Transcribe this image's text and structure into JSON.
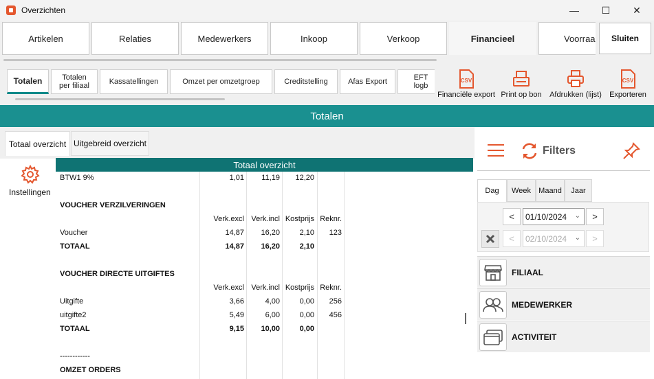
{
  "window": {
    "title": "Overzichten",
    "controls": [
      "minimize",
      "maximize",
      "close"
    ]
  },
  "main_tabs": [
    "Artikelen",
    "Relaties",
    "Medewerkers",
    "Inkoop",
    "Verkoop",
    "Financieel",
    "Voorraa"
  ],
  "main_tabs_active": "Financieel",
  "close_label": "Sluiten",
  "sub_tabs": [
    "Totalen",
    "Totalen per filiaal",
    "Kassatellingen",
    "Omzet per omzetgroep",
    "Creditstelling",
    "Afas Export",
    "EFT logb"
  ],
  "sub_tabs_active": "Totalen",
  "toolbar": [
    {
      "label": "Financiële export",
      "icon": "csv-file-icon"
    },
    {
      "label": "Print op bon",
      "icon": "receipt-printer-icon"
    },
    {
      "label": "Afdrukken (lijst)",
      "icon": "printer-icon"
    },
    {
      "label": "Exporteren",
      "icon": "csv-file-icon"
    }
  ],
  "header_title": "Totalen",
  "content_tabs": [
    "Totaal overzicht",
    "Uitgebreid overzicht"
  ],
  "content_tabs_active": "Totaal overzicht",
  "settings_label": "Instellingen",
  "table": {
    "title": "Totaal overzicht",
    "rows": [
      {
        "label": "BTW1 9%",
        "bold": false,
        "values": [
          "1,01",
          "11,19",
          "12,20",
          ""
        ]
      },
      {
        "label": "",
        "bold": false,
        "values": [
          "",
          "",
          "",
          ""
        ]
      },
      {
        "label": "VOUCHER VERZILVERINGEN",
        "bold": true,
        "values": [
          "",
          "",
          "",
          ""
        ]
      },
      {
        "label": "",
        "bold": false,
        "values": [
          "Verk.excl",
          "Verk.incl",
          "Kostprijs",
          "Reknr."
        ]
      },
      {
        "label": "Voucher",
        "bold": false,
        "values": [
          "14,87",
          "16,20",
          "2,10",
          "123"
        ]
      },
      {
        "label": "TOTAAL",
        "bold": true,
        "values": [
          "14,87",
          "16,20",
          "2,10",
          ""
        ]
      },
      {
        "label": "",
        "bold": false,
        "values": [
          "",
          "",
          "",
          ""
        ]
      },
      {
        "label": "VOUCHER DIRECTE UITGIFTES",
        "bold": true,
        "values": [
          "",
          "",
          "",
          ""
        ]
      },
      {
        "label": "",
        "bold": false,
        "values": [
          "Verk.excl",
          "Verk.incl",
          "Kostprijs",
          "Reknr."
        ]
      },
      {
        "label": "Uitgifte",
        "bold": false,
        "values": [
          "3,66",
          "4,00",
          "0,00",
          "256"
        ]
      },
      {
        "label": "uitgifte2",
        "bold": false,
        "values": [
          "5,49",
          "6,00",
          "0,00",
          "456"
        ]
      },
      {
        "label": "TOTAAL",
        "bold": true,
        "values": [
          "9,15",
          "10,00",
          "0,00",
          ""
        ]
      },
      {
        "label": "",
        "bold": false,
        "values": [
          "",
          "",
          "",
          ""
        ]
      },
      {
        "label": "------------",
        "bold": false,
        "values": [
          "",
          "",
          "",
          ""
        ]
      },
      {
        "label": "OMZET ORDERS",
        "bold": true,
        "values": [
          "",
          "",
          "",
          ""
        ]
      }
    ]
  },
  "filters": {
    "title": "Filters",
    "period_tabs": [
      "Dag",
      "Week",
      "Maand",
      "Jaar"
    ],
    "period_active": "Dag",
    "date_from": "01/10/2024",
    "date_to": "02/10/2024",
    "prev": "<",
    "next": ">",
    "sections": [
      {
        "label": "FILIAAL",
        "icon": "store-icon"
      },
      {
        "label": "MEDEWERKER",
        "icon": "users-icon"
      },
      {
        "label": "ACTIVITEIT",
        "icon": "windows-icon"
      }
    ]
  },
  "colors": {
    "accent": "#1a9090",
    "table_header": "#0f7373",
    "icon_orange": "#e4572e"
  }
}
